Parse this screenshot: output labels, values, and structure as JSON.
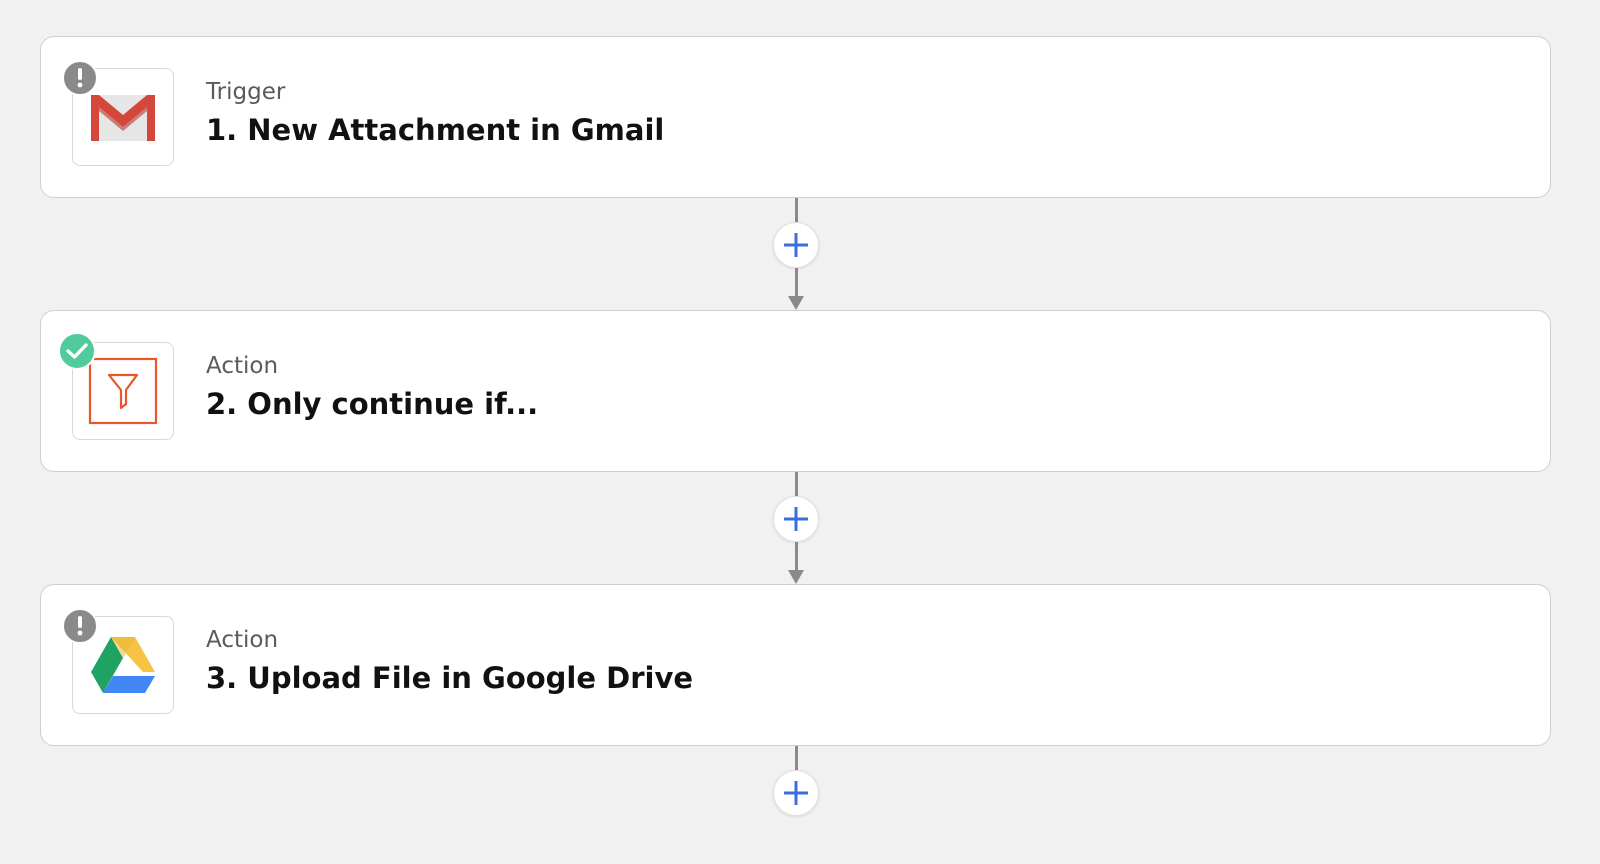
{
  "steps": [
    {
      "type": "Trigger",
      "title": "1. New Attachment in Gmail",
      "app_icon": "gmail-icon",
      "status": "warning"
    },
    {
      "type": "Action",
      "title": "2. Only continue if...",
      "app_icon": "filter-icon",
      "status": "complete"
    },
    {
      "type": "Action",
      "title": "3. Upload File in Google Drive",
      "app_icon": "google-drive-icon",
      "status": "warning"
    }
  ],
  "add_step_icon": "plus-icon",
  "colors": {
    "background": "#f1f1f1",
    "card": "#ffffff",
    "warning_badge": "#8a8a8a",
    "complete_badge": "#4fcb9e",
    "plus": "#3a6de0",
    "filter": "#e8572a",
    "connector": "#8a8a8a"
  }
}
